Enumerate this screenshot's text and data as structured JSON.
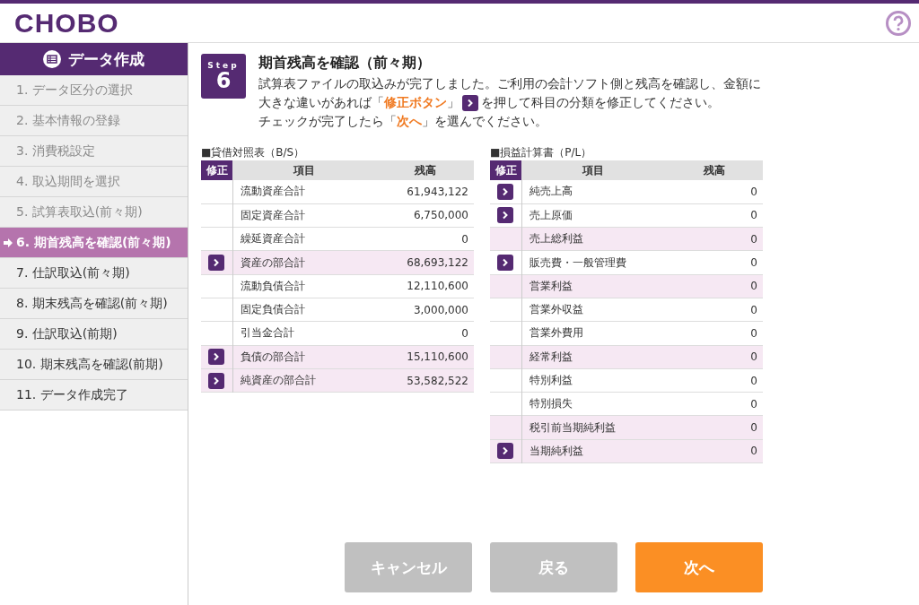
{
  "header": {
    "logo": "CHOBO"
  },
  "sidebar": {
    "title": "データ作成",
    "items": [
      {
        "label": "1. データ区分の選択",
        "done": true,
        "selected": false
      },
      {
        "label": "2. 基本情報の登録",
        "done": true,
        "selected": false
      },
      {
        "label": "3. 消費税設定",
        "done": true,
        "selected": false
      },
      {
        "label": "4. 取込期間を選択",
        "done": true,
        "selected": false
      },
      {
        "label": "5. 試算表取込(前々期)",
        "done": true,
        "selected": false
      },
      {
        "label": "6. 期首残高を確認(前々期)",
        "done": false,
        "selected": true
      },
      {
        "label": "7. 仕訳取込(前々期)",
        "done": false,
        "selected": false
      },
      {
        "label": "8. 期末残高を確認(前々期)",
        "done": false,
        "selected": false
      },
      {
        "label": "9. 仕訳取込(前期)",
        "done": false,
        "selected": false
      },
      {
        "label": "10. 期末残高を確認(前期)",
        "done": false,
        "selected": false
      },
      {
        "label": "11. データ作成完了",
        "done": false,
        "selected": false
      }
    ]
  },
  "step": {
    "label": "Step",
    "number": "6",
    "title": "期首残高を確認（前々期）",
    "lines": [
      {
        "text": "試算表ファイルの取込みが完了しました。ご利用の会計ソフト側と残高を確認し、金額に"
      },
      {
        "text": "大きな違いがあれば「**修正ボタン**」",
        "after": "を押して科目の分類を修正してください。"
      },
      {
        "text": "チェックが完了したら「**次へ**」を選んでください。"
      }
    ]
  },
  "tables": [
    {
      "title": "■貸借対照表（B/S）",
      "columns": [
        "修正",
        "項目",
        "残高"
      ],
      "rows": [
        {
          "item": "流動資産合計",
          "balance": "61,943,122",
          "editable": false,
          "subtotal": false
        },
        {
          "item": "固定資産合計",
          "balance": "6,750,000",
          "editable": false,
          "subtotal": false
        },
        {
          "item": "繰延資産合計",
          "balance": "0",
          "editable": false,
          "subtotal": false
        },
        {
          "item": "資産の部合計",
          "balance": "68,693,122",
          "editable": true,
          "subtotal": true
        },
        {
          "item": "流動負債合計",
          "balance": "12,110,600",
          "editable": false,
          "subtotal": false
        },
        {
          "item": "固定負債合計",
          "balance": "3,000,000",
          "editable": false,
          "subtotal": false
        },
        {
          "item": "引当金合計",
          "balance": "0",
          "editable": false,
          "subtotal": false
        },
        {
          "item": "負債の部合計",
          "balance": "15,110,600",
          "editable": true,
          "subtotal": true
        },
        {
          "item": "純資産の部合計",
          "balance": "53,582,522",
          "editable": true,
          "subtotal": true
        }
      ]
    },
    {
      "title": "■損益計算書（P/L）",
      "columns": [
        "修正",
        "項目",
        "残高"
      ],
      "rows": [
        {
          "item": "純売上高",
          "balance": "0",
          "editable": true,
          "subtotal": false
        },
        {
          "item": "売上原価",
          "balance": "0",
          "editable": true,
          "subtotal": false
        },
        {
          "item": "売上総利益",
          "balance": "0",
          "editable": false,
          "subtotal": true
        },
        {
          "item": "販売費・一般管理費",
          "balance": "0",
          "editable": true,
          "subtotal": false
        },
        {
          "item": "営業利益",
          "balance": "0",
          "editable": false,
          "subtotal": true
        },
        {
          "item": "営業外収益",
          "balance": "0",
          "editable": false,
          "subtotal": false
        },
        {
          "item": "営業外費用",
          "balance": "0",
          "editable": false,
          "subtotal": false
        },
        {
          "item": "経常利益",
          "balance": "0",
          "editable": false,
          "subtotal": true
        },
        {
          "item": "特別利益",
          "balance": "0",
          "editable": false,
          "subtotal": false
        },
        {
          "item": "特別損失",
          "balance": "0",
          "editable": false,
          "subtotal": false
        },
        {
          "item": "税引前当期純利益",
          "balance": "0",
          "editable": false,
          "subtotal": true
        },
        {
          "item": "当期純利益",
          "balance": "0",
          "editable": true,
          "subtotal": true
        }
      ]
    }
  ],
  "buttons": [
    {
      "label": "キャンセル",
      "kind": "disabled"
    },
    {
      "label": "戻る",
      "kind": "disabled"
    },
    {
      "label": "次へ",
      "kind": "primary"
    }
  ]
}
